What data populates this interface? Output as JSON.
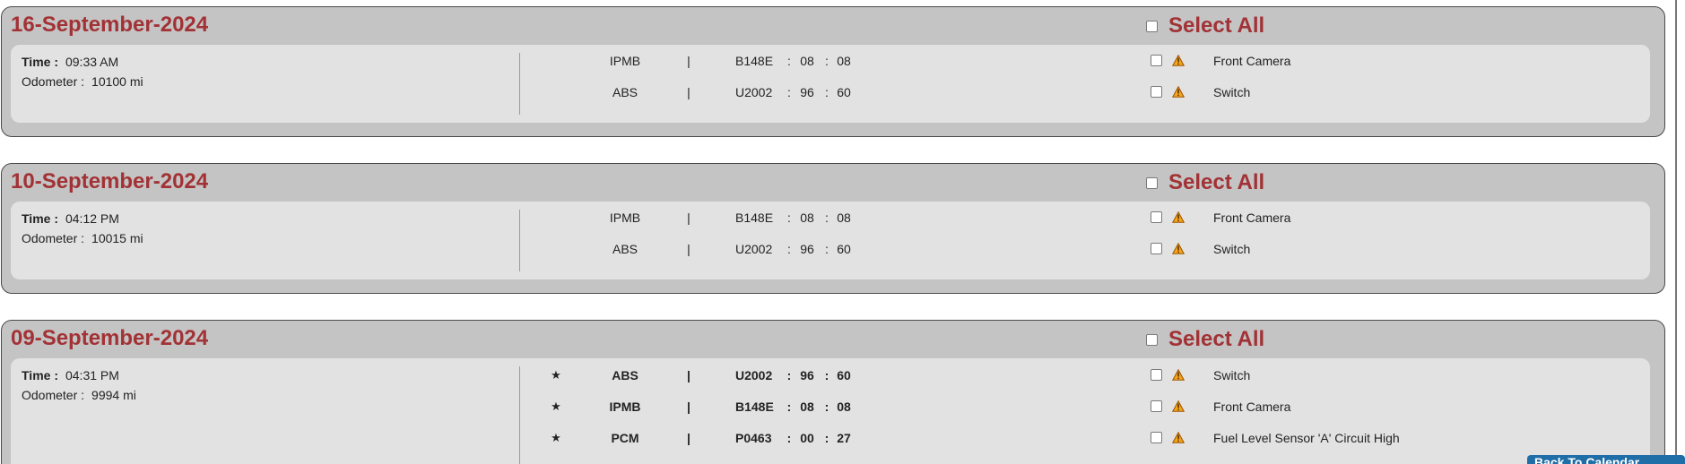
{
  "diagnostic_days": [
    {
      "date": "16-September-2024",
      "select_all_label": "Select All",
      "time_label": "Time :",
      "time": "09:33 AM",
      "odometer_label": "Odometer :",
      "odometer": "10100 mi",
      "faults": [
        {
          "star": "",
          "module": "IPMB",
          "separator": "|",
          "code": "B148E",
          "colon_1": ":",
          "value_1": "08",
          "colon_2": ":",
          "value_2": "08",
          "description": "Front Camera"
        },
        {
          "star": "",
          "module": "ABS",
          "separator": "|",
          "code": "U2002",
          "colon_1": ":",
          "value_1": "96",
          "colon_2": ":",
          "value_2": "60",
          "description": "Switch"
        }
      ]
    },
    {
      "date": "10-September-2024",
      "select_all_label": "Select All",
      "time_label": "Time :",
      "time": "04:12 PM",
      "odometer_label": "Odometer :",
      "odometer": "10015 mi",
      "faults": [
        {
          "star": "",
          "module": "IPMB",
          "separator": "|",
          "code": "B148E",
          "colon_1": ":",
          "value_1": "08",
          "colon_2": ":",
          "value_2": "08",
          "description": "Front Camera"
        },
        {
          "star": "",
          "module": "ABS",
          "separator": "|",
          "code": "U2002",
          "colon_1": ":",
          "value_1": "96",
          "colon_2": ":",
          "value_2": "60",
          "description": "Switch"
        }
      ]
    },
    {
      "date": "09-September-2024",
      "select_all_label": "Select All",
      "time_label": "Time :",
      "time": "04:31 PM",
      "odometer_label": "Odometer :",
      "odometer": "9994 mi",
      "faults": [
        {
          "star": "★",
          "module": "ABS",
          "separator": "|",
          "code": "U2002",
          "colon_1": ":",
          "value_1": "96",
          "colon_2": ":",
          "value_2": "60",
          "description": "Switch"
        },
        {
          "star": "★",
          "module": "IPMB",
          "separator": "|",
          "code": "B148E",
          "colon_1": ":",
          "value_1": "08",
          "colon_2": ":",
          "value_2": "08",
          "description": "Front Camera"
        },
        {
          "star": "★",
          "module": "PCM",
          "separator": "|",
          "code": "P0463",
          "colon_1": ":",
          "value_1": "00",
          "colon_2": ":",
          "value_2": "27",
          "description": "Fuel Level Sensor 'A' Circuit High"
        }
      ]
    }
  ],
  "checkbox_state": {
    "select_all_checked": false,
    "fault_checked": false
  },
  "icons": {
    "fault_status": "warning-triangle-icon",
    "new_fault": "star-icon"
  },
  "colors": {
    "date_heading": "#a23235",
    "card_background": "#c4c4c4",
    "panel_background": "#e2e2e2",
    "warning_fill": "#f4a51c",
    "warning_stroke": "#9c5200",
    "scroll_button": "#1f6ea8"
  },
  "scroll_to_top": {
    "label": "Back To Calendar"
  }
}
